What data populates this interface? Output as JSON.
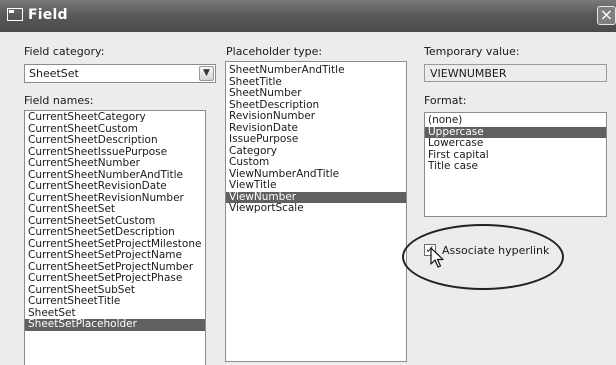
{
  "window": {
    "title": "Field",
    "close": "×"
  },
  "field_category": {
    "label": "Field category:",
    "value": "SheetSet",
    "dropdown": "▼"
  },
  "field_names": {
    "label": "Field names:",
    "items": [
      "CurrentSheetCategory",
      "CurrentSheetCustom",
      "CurrentSheetDescription",
      "CurrentSheetIssuePurpose",
      "CurrentSheetNumber",
      "CurrentSheetNumberAndTitle",
      "CurrentSheetRevisionDate",
      "CurrentSheetRevisionNumber",
      "CurrentSheetSet",
      "CurrentSheetSetCustom",
      "CurrentSheetSetDescription",
      "CurrentSheetSetProjectMilestone",
      "CurrentSheetSetProjectName",
      "CurrentSheetSetProjectNumber",
      "CurrentSheetSetProjectPhase",
      "CurrentSheetSubSet",
      "CurrentSheetTitle",
      "SheetSet",
      "SheetSetPlaceholder"
    ],
    "selected": "SheetSetPlaceholder"
  },
  "placeholder_type": {
    "label": "Placeholder type:",
    "items": [
      "SheetNumberAndTitle",
      "SheetTitle",
      "SheetNumber",
      "SheetDescription",
      "RevisionNumber",
      "RevisionDate",
      "IssuePurpose",
      "Category",
      "Custom",
      "ViewNumberAndTitle",
      "ViewTitle",
      "ViewNumber",
      "ViewportScale"
    ],
    "selected": "ViewNumber"
  },
  "temporary_value": {
    "label": "Temporary value:",
    "value": "VIEWNUMBER"
  },
  "format": {
    "label": "Format:",
    "items": [
      "(none)",
      "Uppercase",
      "Lowercase",
      "First capital",
      "Title case"
    ],
    "selected": "Uppercase"
  },
  "associate_hyperlink": {
    "label": "Associate hyperlink",
    "checked": true,
    "mark": "✓"
  }
}
